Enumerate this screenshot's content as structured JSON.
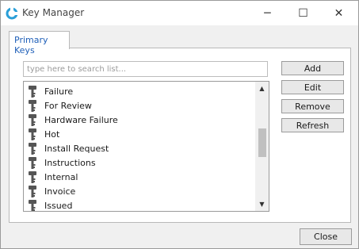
{
  "window": {
    "title": "Key Manager",
    "app_icon": "key-manager-logo-icon",
    "controls": {
      "minimize": "─",
      "maximize": "☐",
      "close": "✕"
    }
  },
  "tabs": [
    {
      "label": "Primary Keys",
      "selected": true
    }
  ],
  "search": {
    "placeholder": "type here to search list...",
    "value": ""
  },
  "list": {
    "items": [
      "Failure",
      "For Review",
      "Hardware Failure",
      "Hot",
      "Install Request",
      "Instructions",
      "Internal",
      "Invoice",
      "Issued"
    ],
    "item_icon": "key-icon",
    "scroll_position": 0.45,
    "visible_fraction": 0.28
  },
  "buttons": {
    "add": "Add",
    "edit": "Edit",
    "remove": "Remove",
    "refresh": "Refresh"
  },
  "footer": {
    "close": "Close"
  },
  "colors": {
    "accent": "#1f5fb8",
    "logo": "#2a9fd8"
  }
}
